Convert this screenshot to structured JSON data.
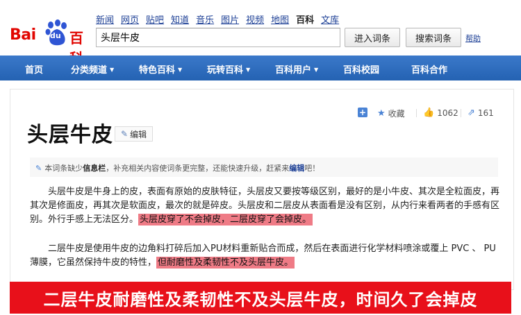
{
  "logo": {
    "bai": "Bai",
    "du": "du",
    "baike": "百科"
  },
  "topnav": [
    {
      "label": "新闻",
      "active": false
    },
    {
      "label": "网页",
      "active": false
    },
    {
      "label": "贴吧",
      "active": false
    },
    {
      "label": "知道",
      "active": false
    },
    {
      "label": "音乐",
      "active": false
    },
    {
      "label": "图片",
      "active": false
    },
    {
      "label": "视频",
      "active": false
    },
    {
      "label": "地图",
      "active": false
    },
    {
      "label": "百科",
      "active": true
    },
    {
      "label": "文库",
      "active": false
    }
  ],
  "search": {
    "value": "头层牛皮",
    "enter_label": "进入词条",
    "search_label": "搜索词条",
    "help": "帮助"
  },
  "mainnav": [
    {
      "label": "首页",
      "caret": false
    },
    {
      "label": "分类频道",
      "caret": true
    },
    {
      "label": "特色百科",
      "caret": true
    },
    {
      "label": "玩转百科",
      "caret": true
    },
    {
      "label": "百科用户",
      "caret": true
    },
    {
      "label": "百科校园",
      "caret": false
    },
    {
      "label": "百科合作",
      "caret": false
    }
  ],
  "article": {
    "title": "头层牛皮",
    "edit_label": "编辑",
    "fav_label": "收藏",
    "like_count": "1062",
    "share_count": "161",
    "notice": {
      "prefix": "本词条缺少",
      "bold": "信息栏",
      "middle": "，补充相关内容使词条更完整，还能快速升级，赶紧来",
      "link": "编辑",
      "suffix": "吧！"
    },
    "para1": "头层牛皮是牛身上的皮，表面有原始的皮肤特征，头层皮又要按等级区别，最好的是小牛皮、其次是全粒面皮，再其次是修面皮，再其次是软面皮，最次的就是碎皮。头层皮和二层皮从表面看是没有区别，从内行来看两者的手感有区别。外行手感上无法区分。",
    "para1_highlight": "头层皮穿了不会掉皮，二层皮穿了会掉皮。",
    "para2": "二层牛皮是使用牛皮的边角料打碎后加入PU材料重新贴合而成，然后在表面进行化学材料喷涂或覆上 PVC 、 PU 薄膜，它虽然保持牛皮的特性，",
    "para2_highlight": "但耐磨性及柔韧性不及头层牛皮。"
  },
  "banner": "二层牛皮耐磨性及柔韧性不及头层牛皮，时间久了会掉皮",
  "colors": {
    "nav_blue": "#2d6ec3",
    "banner_red": "#e8101a",
    "highlight": "#ef7b86",
    "link": "#1c3f95"
  }
}
